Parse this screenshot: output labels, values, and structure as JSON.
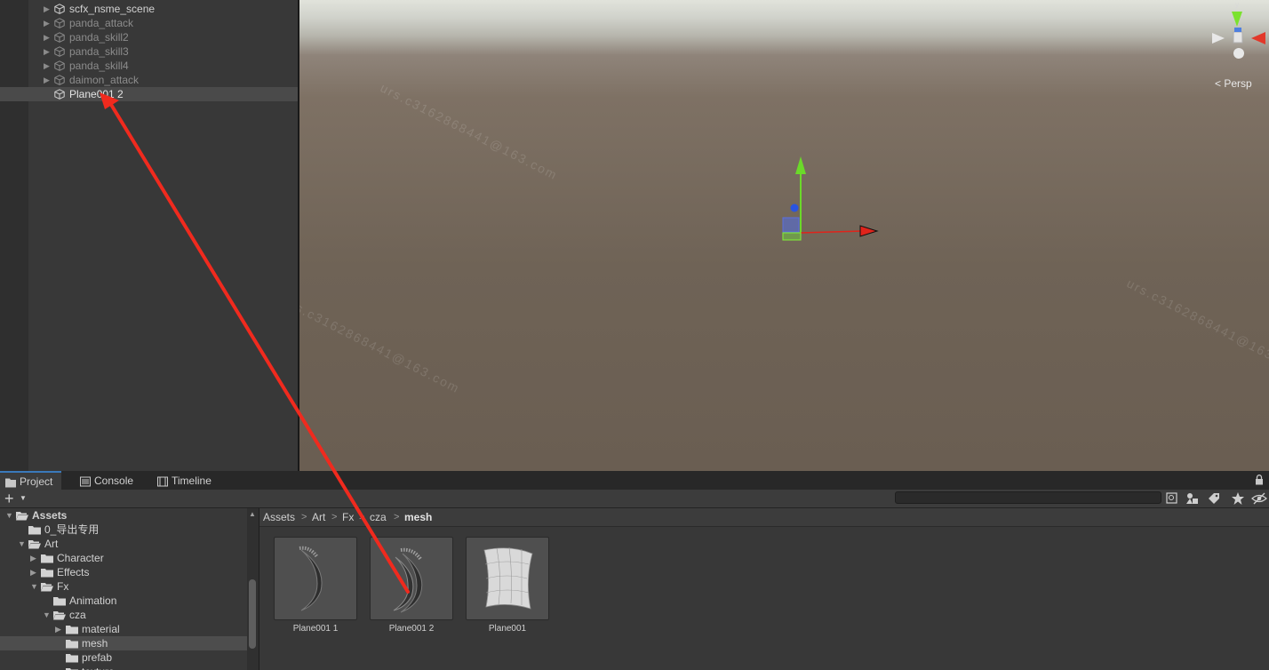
{
  "hierarchy": {
    "items": [
      {
        "label": "scfx_nsme_scene",
        "dim": false
      },
      {
        "label": "panda_attack",
        "dim": true
      },
      {
        "label": "panda_skill2",
        "dim": true
      },
      {
        "label": "panda_skill3",
        "dim": true
      },
      {
        "label": "panda_skill4",
        "dim": true
      },
      {
        "label": "daimon_attack",
        "dim": true
      },
      {
        "label": "Plane001 2",
        "dim": false,
        "active": true
      }
    ]
  },
  "scene": {
    "projection_label": "Persp",
    "gizmo_axis_y": "y",
    "watermark": "urs.c3162868441@163.com"
  },
  "bottom_tabs": [
    {
      "label": "Project",
      "icon": "folder-icon",
      "active": true
    },
    {
      "label": "Console",
      "icon": "console-icon",
      "active": false
    },
    {
      "label": "Timeline",
      "icon": "timeline-icon",
      "active": false
    }
  ],
  "toolbar": {
    "add_label": "+",
    "search_placeholder": ""
  },
  "tree": [
    {
      "label": "Assets",
      "depth": 0,
      "expanded": true,
      "bold": true
    },
    {
      "label": "0_导出专用",
      "depth": 1,
      "expanded": null
    },
    {
      "label": "Art",
      "depth": 1,
      "expanded": true
    },
    {
      "label": "Character",
      "depth": 2,
      "expanded": false
    },
    {
      "label": "Effects",
      "depth": 2,
      "expanded": false
    },
    {
      "label": "Fx",
      "depth": 2,
      "expanded": true
    },
    {
      "label": "Animation",
      "depth": 3,
      "expanded": null
    },
    {
      "label": "cza",
      "depth": 3,
      "expanded": true
    },
    {
      "label": "material",
      "depth": 4,
      "expanded": false
    },
    {
      "label": "mesh",
      "depth": 4,
      "expanded": null,
      "selected": true
    },
    {
      "label": "prefab",
      "depth": 4,
      "expanded": null
    },
    {
      "label": "texture",
      "depth": 4,
      "expanded": null
    }
  ],
  "breadcrumb": [
    "Assets",
    "Art",
    "Fx",
    "cza",
    "mesh"
  ],
  "assets": [
    {
      "name": "Plane001 1",
      "kind": "claw"
    },
    {
      "name": "Plane001 2",
      "kind": "claw-double"
    },
    {
      "name": "Plane001",
      "kind": "curved-plane"
    }
  ],
  "colors": {
    "accent": "#3a79bb",
    "annotation_arrow": "#f02a1e",
    "axis_x": "#e0241b",
    "axis_y": "#6bd92a",
    "axis_z": "#2a54e0"
  }
}
